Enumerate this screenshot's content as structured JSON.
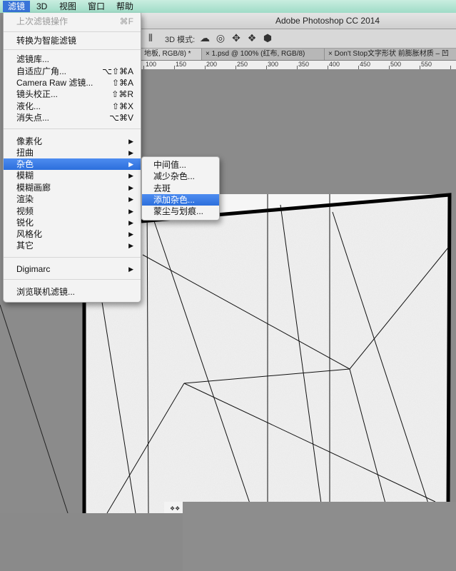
{
  "menubar": {
    "items": [
      {
        "label": "滤镜",
        "active": true
      },
      {
        "label": "3D",
        "active": false
      },
      {
        "label": "视图",
        "active": false
      },
      {
        "label": "窗口",
        "active": false
      },
      {
        "label": "帮助",
        "active": false
      }
    ]
  },
  "window": {
    "title": "Adobe Photoshop CC 2014"
  },
  "options_bar": {
    "mode_label": "3D 模式:"
  },
  "tabs": [
    {
      "label": "地板, RGB/8) *"
    },
    {
      "label": "× 1.psd @ 100% (红布, RGB/8)"
    },
    {
      "label": "× Don't Stop文字形状 前膨胀材质 – 凹"
    }
  ],
  "ruler": {
    "labels": [
      "100",
      "150",
      "200",
      "250",
      "300",
      "350",
      "400",
      "450",
      "500",
      "550"
    ]
  },
  "filter_menu": {
    "last_filter": {
      "label": "上次滤镜操作",
      "shortcut": "⌘F"
    },
    "smart_filters": "转换为智能滤镜",
    "filter_gallery": "滤镜库...",
    "adaptive_wide_angle": {
      "label": "自适应广角...",
      "shortcut": "⌥⇧⌘A"
    },
    "camera_raw": {
      "label": "Camera Raw 滤镜...",
      "shortcut": "⇧⌘A"
    },
    "lens_correction": {
      "label": "镜头校正...",
      "shortcut": "⇧⌘R"
    },
    "liquify": {
      "label": "液化...",
      "shortcut": "⇧⌘X"
    },
    "vanishing_point": {
      "label": "消失点...",
      "shortcut": "⌥⌘V"
    },
    "categories": [
      "像素化",
      "扭曲",
      "杂色",
      "模糊",
      "模糊画廊",
      "渲染",
      "视频",
      "锐化",
      "风格化",
      "其它"
    ],
    "digimarc": "Digimarc",
    "browse_online": "浏览联机滤镜...",
    "submenu_arrow": "▶"
  },
  "noise_submenu": {
    "items": [
      "中间值...",
      "减少杂色...",
      "去斑",
      "添加杂色...",
      "蒙尘与划痕..."
    ]
  },
  "canvas_note": "❖❖"
}
